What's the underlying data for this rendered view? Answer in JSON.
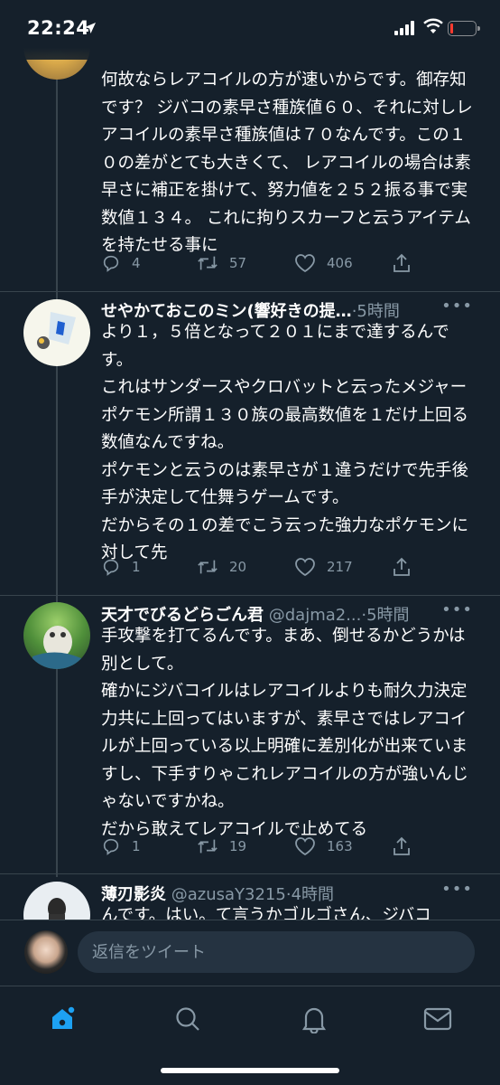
{
  "status_bar": {
    "time": "22:24"
  },
  "tweets": [
    {
      "body": "何故ならレアコイルの方が速いからです。御存知です？ ジバコの素早さ種族値６０、それに対しレアコイルの素早さ種族値は７０なんです。この１０の差がとても大きくて、 レアコイルの場合は素早さに補正を掛けて、努力値を２５２振る事で実数値１３４。 これに拘りスカーフと云うアイテムを持たせる事に",
      "replies": "4",
      "retweets": "57",
      "likes": "406"
    },
    {
      "name": "せやかておこのミン(響好きの提…",
      "handle": "",
      "time": "·5時間",
      "body": "より１，５倍となって２０１にまで達するんです。\nこれはサンダースやクロバットと云ったメジャーポケモン所謂１３０族の最高数値を１だけ上回る数値なんですね。\nポケモンと云うのは素早さが１違うだけで先手後手が決定して仕舞うゲームです。\nだからその１の差でこう云った強力なポケモンに対して先",
      "replies": "1",
      "retweets": "20",
      "likes": "217"
    },
    {
      "name": "天才でびるどらごん君",
      "handle": "@dajma2...",
      "time": "·5時間",
      "body": "手攻撃を打てるんです。まあ、倒せるかどうかは別として。\n確かにジバコイルはレアコイルよりも耐久力決定力共に上回ってはいますが、素早さではレアコイルが上回っている以上明確に差別化が出来ていますし、下手すりゃこれレアコイルの方が強いんじゃないですかね。\nだから敢えてレアコイルで止めてる",
      "replies": "1",
      "retweets": "19",
      "likes": "163"
    },
    {
      "name": "薄刃影炎",
      "handle": "@azusaY3215",
      "time": "·4時間",
      "body": "んです。はい。て言うかゴルゴさん、ジバコ"
    }
  ],
  "composer": {
    "placeholder": "返信をツイート"
  },
  "tabs": [
    "home-icon",
    "search-icon",
    "notifications-icon",
    "messages-icon"
  ],
  "colors": {
    "background": "#15202b",
    "secondary_text": "#8899a6",
    "accent": "#1da1f2",
    "divider": "#38444d",
    "battery_low": "#ff3b30"
  }
}
